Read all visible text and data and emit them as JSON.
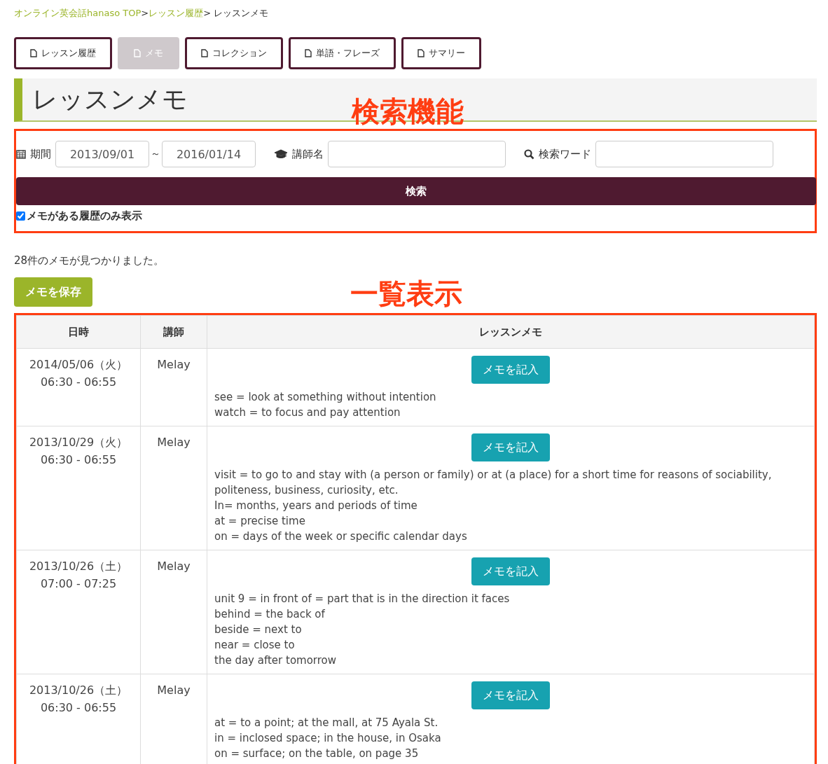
{
  "breadcrumb": {
    "links": [
      "オンライン英会話hanaso TOP",
      "レッスン履歴"
    ],
    "separator": ">",
    "current": "レッスンメモ"
  },
  "tabs": [
    {
      "label": "レッスン履歴",
      "selected": false
    },
    {
      "label": "メモ",
      "selected": true
    },
    {
      "label": "コレクション",
      "selected": false
    },
    {
      "label": "単語・フレーズ",
      "selected": false
    },
    {
      "label": "サマリー",
      "selected": false
    }
  ],
  "page_title": "レッスンメモ",
  "annotations": {
    "search_label": "検索機能",
    "list_label": "一覧表示"
  },
  "search": {
    "period_label": "期間",
    "date_from": "2013/09/01",
    "range_sep": "～",
    "date_to": "2016/01/14",
    "teacher_label": "講師名",
    "keyword_label": "検索ワード",
    "button": "検索",
    "memo_only": {
      "label": "メモがある履歴のみ表示",
      "checked": true
    }
  },
  "result_count": "28件のメモが見つかりました。",
  "save_button": "メモを保存",
  "table": {
    "columns": [
      "日時",
      "講師",
      "レッスンメモ"
    ],
    "rows": [
      {
        "date": "2014/05/06（火）",
        "time": "06:30 - 06:55",
        "teacher": "Melay",
        "button": "メモを記入",
        "memo": [
          "see = look at something without intention",
          "watch = to focus and pay attention"
        ]
      },
      {
        "date": "2013/10/29（火）",
        "time": "06:30 - 06:55",
        "teacher": "Melay",
        "button": "メモを記入",
        "memo": [
          "visit = to go to and stay with (a person or family) or at (a place) for a short time for reasons of sociability, politeness, business, curiosity, etc.",
          "In= months, years and periods of time",
          "at = precise time",
          "on = days of the week or specific calendar days"
        ]
      },
      {
        "date": "2013/10/26（土）",
        "time": "07:00 - 07:25",
        "teacher": "Melay",
        "button": "メモを記入",
        "memo": [
          "unit 9 = in front of = part that is in the direction it faces",
          "behind = the back of",
          "beside = next to",
          "near = close to",
          "the day after tomorrow"
        ]
      },
      {
        "date": "2013/10/26（土）",
        "time": "06:30 - 06:55",
        "teacher": "Melay",
        "button": "メモを記入",
        "memo": [
          "at = to a point; at the mall, at 75 Ayala St.",
          "in = inclosed space; in the house, in Osaka",
          "on = surface; on the table, on page 35"
        ]
      }
    ]
  }
}
